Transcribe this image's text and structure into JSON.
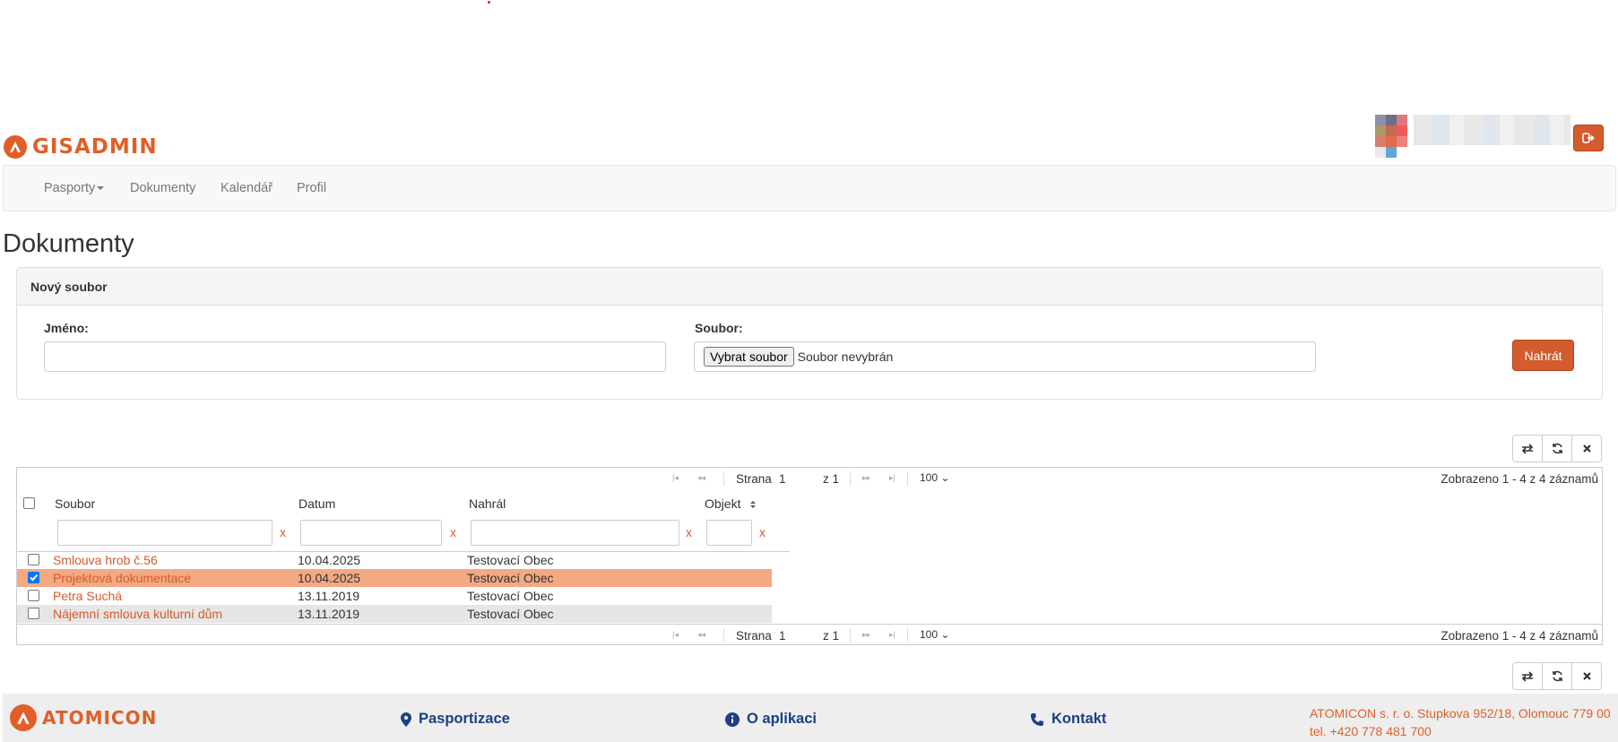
{
  "brand": {
    "name": "GISADMIN",
    "accent": "#e05f28"
  },
  "nav": {
    "items": [
      {
        "label": "Pasporty",
        "has_dropdown": true
      },
      {
        "label": "Dokumenty"
      },
      {
        "label": "Kalendář"
      },
      {
        "label": "Profil"
      }
    ]
  },
  "page": {
    "title": "Dokumenty"
  },
  "upload_panel": {
    "heading": "Nový soubor",
    "name_label": "Jméno:",
    "name_value": "",
    "file_label": "Soubor:",
    "file_button": "Vybrat soubor",
    "file_status": "Soubor nevybrán",
    "submit_label": "Nahrát"
  },
  "toolbar_icons": [
    "swap-icon",
    "refresh-icon",
    "close-icon"
  ],
  "pager": {
    "page_label": "Strana",
    "page_value": "1",
    "of_label": "z 1",
    "page_size": "100",
    "info": "Zobrazeno 1 - 4 z 4 záznamů"
  },
  "grid": {
    "columns": [
      "Soubor",
      "Datum",
      "Nahrál",
      "Objekt"
    ],
    "clear_filter": "x",
    "rows": [
      {
        "file": "Smlouva hrob č.56",
        "date": "10.04.2025",
        "uploader": "Testovací Obec",
        "checked": false
      },
      {
        "file": "Projektová dokumentace",
        "date": "10.04.2025",
        "uploader": "Testovací Obec",
        "checked": true
      },
      {
        "file": "Petra Suchá",
        "date": "13.11.2019",
        "uploader": "Testovací Obec",
        "checked": false
      },
      {
        "file": "Nájemní smlouva kulturní dům",
        "date": "13.11.2019",
        "uploader": "Testovací Obec",
        "checked": false
      }
    ]
  },
  "footer": {
    "brand": "ATOMICON",
    "links": [
      {
        "label": "Pasportizace",
        "icon": "map-marker-icon"
      },
      {
        "label": "O aplikaci",
        "icon": "info-icon"
      },
      {
        "label": "Kontakt",
        "icon": "phone-icon"
      }
    ],
    "address": "ATOMICON s. r. o. Stupkova 952/18, Olomouc 779 00",
    "phone": "tel. +420 778 481 700"
  }
}
